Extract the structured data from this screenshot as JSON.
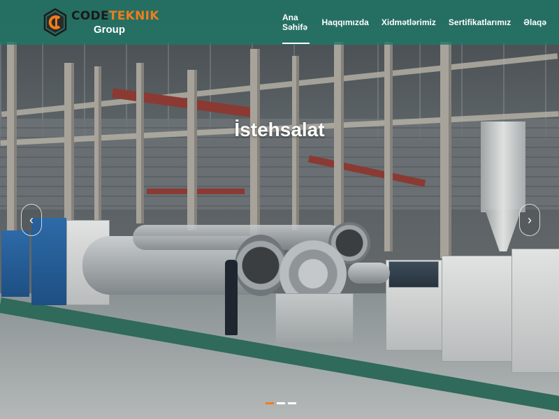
{
  "brand": {
    "name_part1": "CODE",
    "name_part2": "TEKNIK",
    "sub": "Group",
    "colors": {
      "accent": "#f07d1a",
      "dark": "#1a1a1a",
      "header": "#207868"
    }
  },
  "nav": {
    "items": [
      {
        "label": "Ana Səhifə",
        "active": true
      },
      {
        "label": "Haqqımızda",
        "active": false
      },
      {
        "label": "Xidmətlərimiz",
        "active": false
      },
      {
        "label": "Sertifikatlarımız",
        "active": false
      },
      {
        "label": "Əlaqə",
        "active": false
      }
    ]
  },
  "slider": {
    "title": "İstehsalat",
    "prev_icon": "chevron-left-icon",
    "next_icon": "chevron-right-icon",
    "prev_glyph": "‹",
    "next_glyph": "›",
    "slide_count": 3,
    "active_slide": 1
  }
}
